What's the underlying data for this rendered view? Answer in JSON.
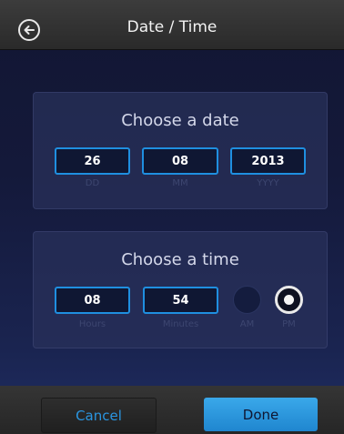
{
  "header": {
    "title": "Date / Time",
    "back_icon": "back-arrow-circle-icon"
  },
  "date_card": {
    "title": "Choose a date",
    "fields": [
      {
        "value": "26",
        "label": "DD"
      },
      {
        "value": "08",
        "label": "MM"
      },
      {
        "value": "2013",
        "label": "YYYY"
      }
    ]
  },
  "time_card": {
    "title": "Choose a time",
    "hours": {
      "value": "08",
      "label": "Hours"
    },
    "minutes": {
      "value": "54",
      "label": "Minutes"
    },
    "am": {
      "label": "AM",
      "selected": false
    },
    "pm": {
      "label": "PM",
      "selected": true
    }
  },
  "actions": {
    "cancel_label": "Cancel",
    "done_label": "Done"
  },
  "colors": {
    "accent": "#1f8fe0",
    "done_button": "#2a97dd",
    "cancel_text": "#2a95e0"
  }
}
